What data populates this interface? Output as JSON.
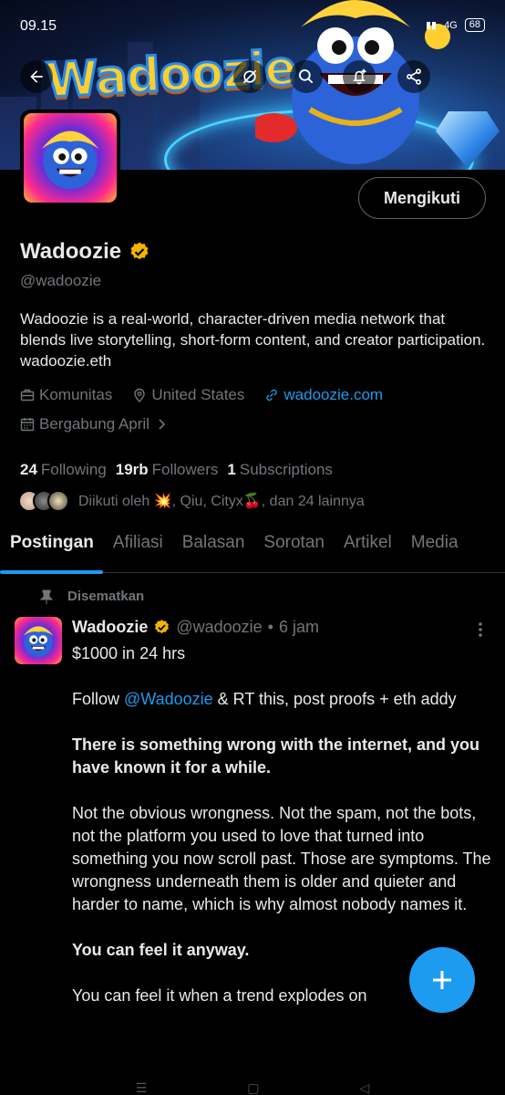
{
  "status_bar": {
    "time": "09.15",
    "network": "4G",
    "battery": "68"
  },
  "banner": {
    "logo_text": "Wadoozie"
  },
  "profile": {
    "name": "Wadoozie",
    "handle": "@wadoozie",
    "follow_button": "Mengikuti",
    "bio": "Wadoozie is a real-world, character-driven media network that blends live storytelling, short-form content, and creator participation. wadoozie.eth",
    "category": "Komunitas",
    "location": "United States",
    "website": "wadoozie.com",
    "joined": "Bergabung April",
    "following_count": "24",
    "following_label": "Following",
    "followers_count": "19rb",
    "followers_label": "Followers",
    "subscriptions_count": "1",
    "subscriptions_label": "Subscriptions",
    "followed_by": "Diikuti oleh 💥, Qiu, Cityx🍒, dan 24 lainnya"
  },
  "tabs": [
    {
      "label": "Postingan",
      "active": true
    },
    {
      "label": "Afiliasi"
    },
    {
      "label": "Balasan"
    },
    {
      "label": "Sorotan"
    },
    {
      "label": "Artikel"
    },
    {
      "label": "Media"
    }
  ],
  "post": {
    "pinned_label": "Disematkan",
    "author": "Wadoozie",
    "handle": "@wadoozie",
    "time": "6 jam",
    "line1": "$1000 in 24 hrs",
    "line2_prefix": "Follow ",
    "line2_mention": "@Wadoozie",
    "line2_suffix": " & RT this, post proofs + eth addy",
    "bold1": "There is something wrong with the internet, and you have known it for a while.",
    "para2": "Not the obvious wrongness. Not the spam, not the bots, not the platform you used to love that turned into something you now scroll past. Those are symptoms. The wrongness underneath them is older and quieter and harder to name, which is why almost nobody names it.",
    "bold2": "You can feel it anyway.",
    "para3": "You can feel it when a trend explodes on"
  },
  "colors": {
    "accent": "#1d9bf0",
    "verified": "#f4b400",
    "background": "#000000"
  }
}
